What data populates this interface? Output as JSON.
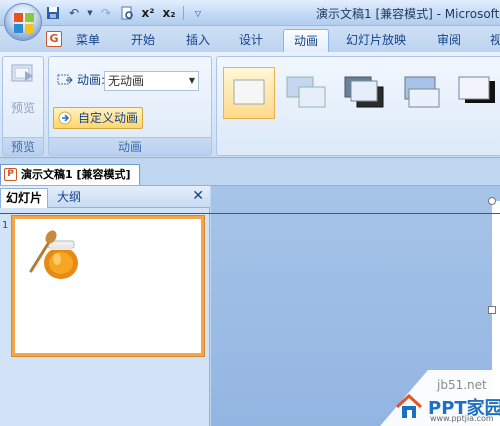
{
  "window": {
    "title": "演示文稿1 [兼容模式] - Microsoft"
  },
  "qat": {
    "save_icon": "save-icon",
    "undo_icon": "undo-icon",
    "redo_icon": "redo-icon",
    "preview_icon": "print-preview-icon",
    "superscript_label": "x²",
    "subscript_label": "x₂"
  },
  "ribbon_tabs": [
    {
      "label": "菜单"
    },
    {
      "label": "开始"
    },
    {
      "label": "插入"
    },
    {
      "label": "设计"
    },
    {
      "label": "动画",
      "active": true
    },
    {
      "label": "幻灯片放映"
    },
    {
      "label": "审阅"
    },
    {
      "label": "视"
    }
  ],
  "groups": {
    "preview": {
      "button_label": "预览",
      "group_label": "预览"
    },
    "animation": {
      "animation_label": "动画:",
      "animation_value": "无动画",
      "custom_button_label": "自定义动画",
      "group_label": "动画"
    }
  },
  "document_tab": {
    "label": "演示文稿1 [兼容模式]"
  },
  "left_pane": {
    "tab_slides": "幻灯片",
    "tab_outline": "大纲",
    "close_label": "✕",
    "slide_number": "1"
  },
  "watermark": {
    "site": "jb51.net",
    "brand": "PPT家园",
    "url": "www.pptjia.com"
  },
  "colors": {
    "accent_orange": "#f3a64a",
    "ribbon_blue": "#d5e5f8",
    "guide_red": "#c8232c"
  }
}
